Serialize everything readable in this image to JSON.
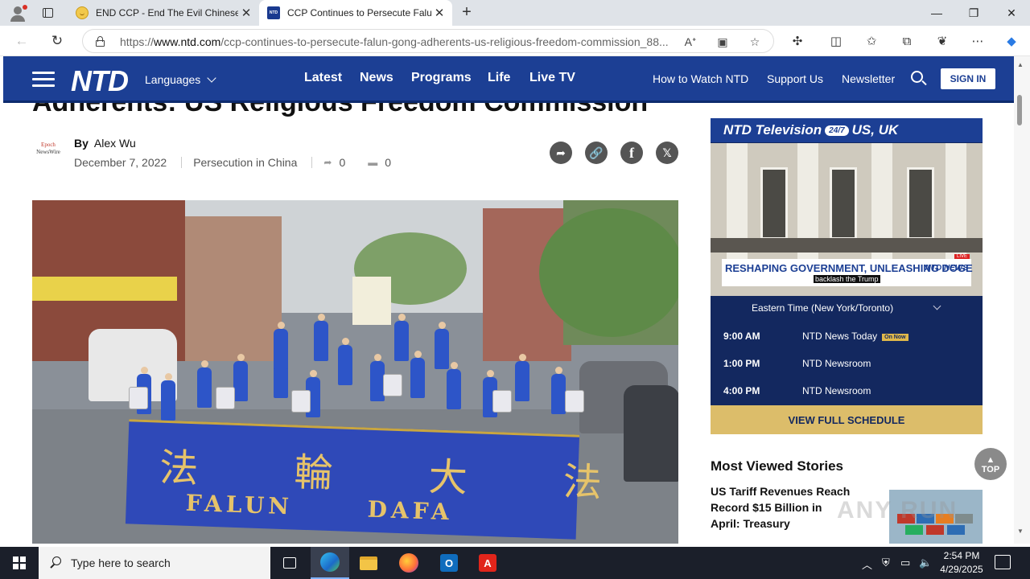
{
  "browser": {
    "tabs": [
      {
        "title": "END CCP - End The Evil Chinese",
        "favicon": "smiley-coin-icon",
        "active": false
      },
      {
        "title": "CCP Continues to Persecute Falu",
        "favicon": "ntd-icon",
        "active": true
      }
    ],
    "url_prefix": "https://",
    "url_domain": "www.ntd.com",
    "url_path": "/ccp-continues-to-persecute-falun-gong-adherents-us-religious-freedom-commission_88..."
  },
  "site": {
    "logo": "NTD",
    "languages_label": "Languages",
    "main_nav": [
      "Latest",
      "News",
      "Programs",
      "Life",
      "Live TV"
    ],
    "right_nav": [
      "How to Watch NTD",
      "Support Us",
      "Newsletter"
    ],
    "signin_label": "SIGN IN",
    "brand_color": "#1c3f94"
  },
  "article": {
    "title_fragment": "Adherents: US Religious Freedom Commission",
    "source_logo_line1": "Epoch",
    "source_logo_line2": "NewsWire",
    "by_label": "By",
    "author": "Alex Wu",
    "date": "December 7, 2022",
    "category": "Persecution in China",
    "share_count": "0",
    "comment_count": "0",
    "photo": {
      "banner_chinese": "法 輪 大 法",
      "banner_word1": "FALUN",
      "banner_word2": "DAFA"
    }
  },
  "sidebar": {
    "tv_title_part1": "NTD Television",
    "tv_badge": "24/7",
    "tv_title_part2": "US, UK",
    "chyron_text": "RESHAPING GOVERNMENT, UNLEASHING DOGE",
    "chyron_sub": "backlash the Trump",
    "chyron_live": "LIVE",
    "chyron_logo": "NTD NEWS",
    "timezone": "Eastern Time (New York/Toronto)",
    "schedule": [
      {
        "time": "9:00 AM",
        "show": "NTD News Today",
        "badge": "On Now"
      },
      {
        "time": "1:00 PM",
        "show": "NTD Newsroom",
        "badge": ""
      },
      {
        "time": "4:00 PM",
        "show": "NTD Newsroom",
        "badge": ""
      }
    ],
    "view_full_label": "VIEW FULL SCHEDULE",
    "most_viewed_heading": "Most Viewed Stories",
    "stories": [
      {
        "title": "US Tariff Revenues Reach Record $15 Billion in April: Treasury"
      }
    ],
    "top_button": "TOP",
    "watermark": "ANY RUN"
  },
  "taskbar": {
    "search_placeholder": "Type here to search",
    "time": "2:54 PM",
    "date": "4/29/2025"
  }
}
